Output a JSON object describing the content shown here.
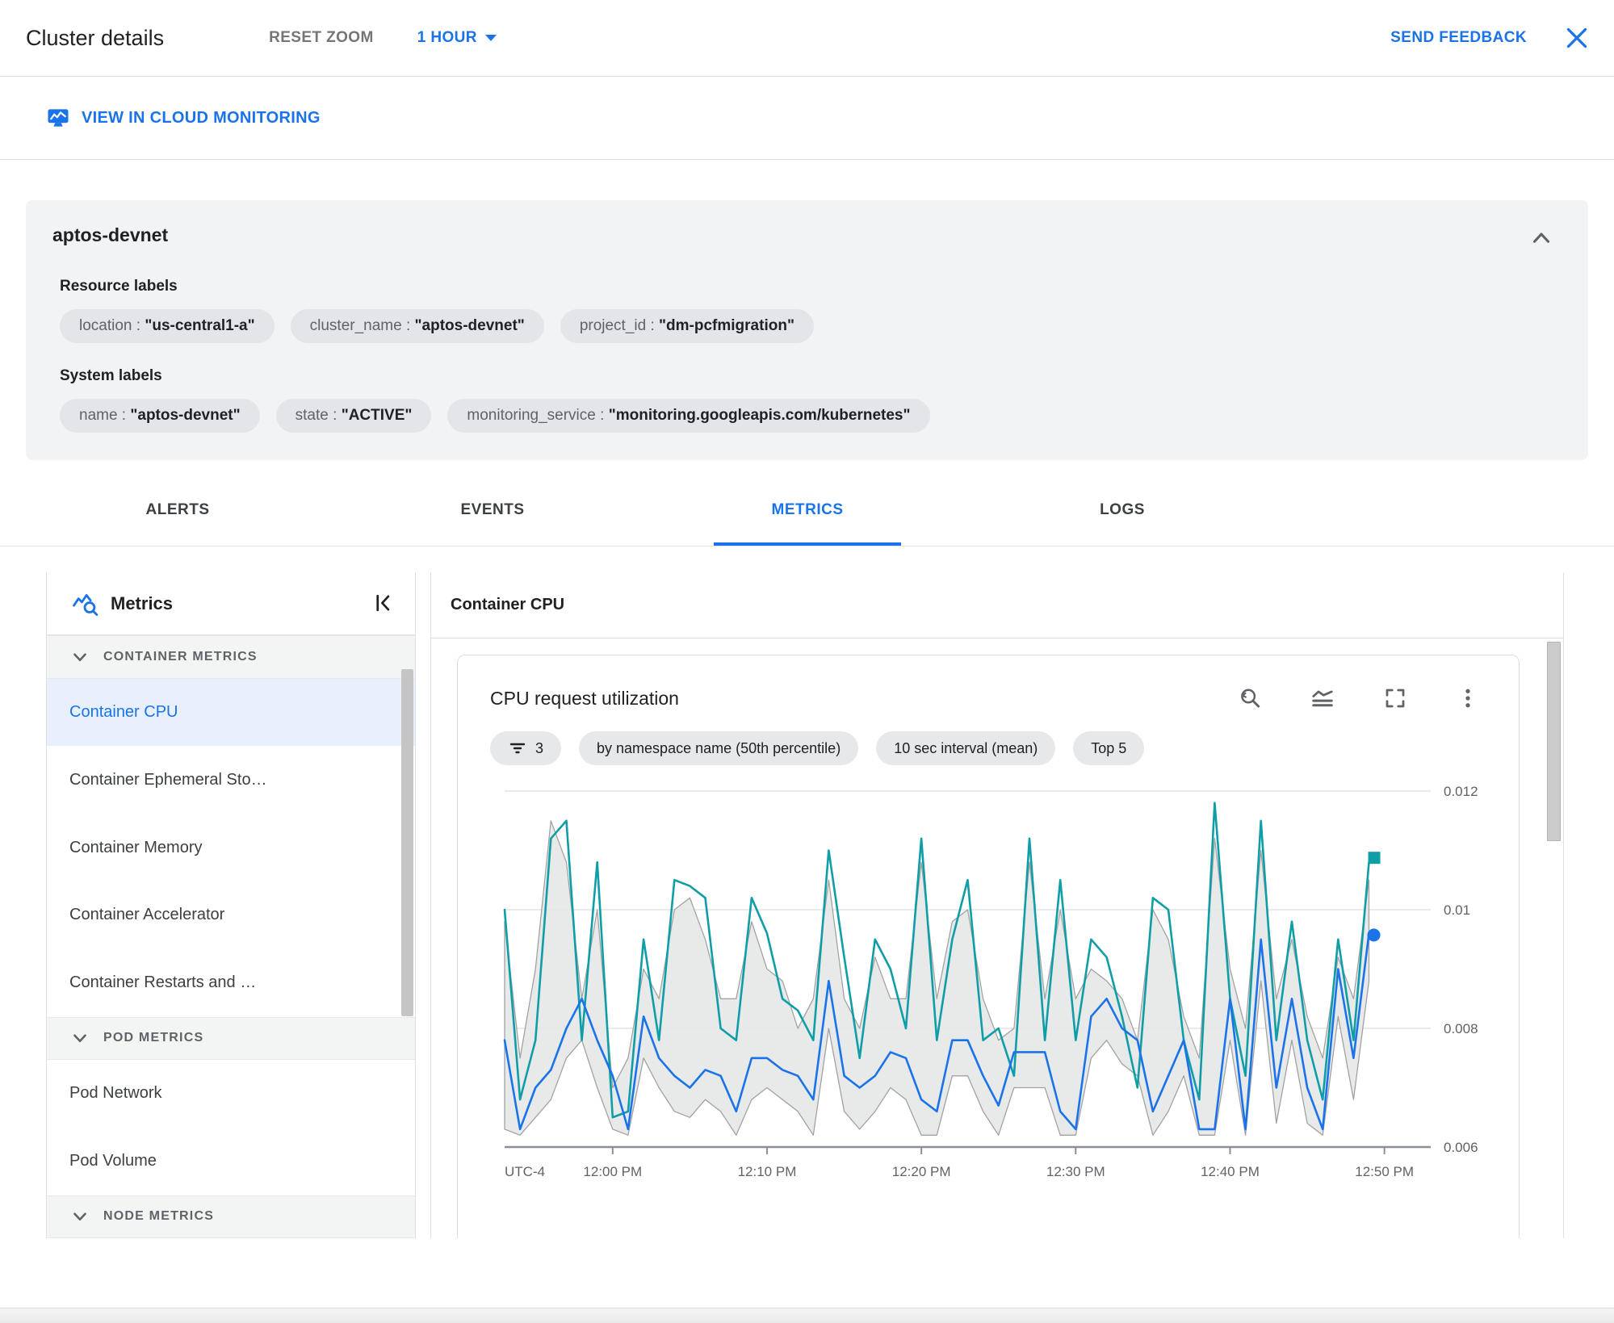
{
  "header": {
    "title": "Cluster details",
    "reset_zoom_label": "RESET ZOOM",
    "time_range_label": "1 HOUR",
    "send_feedback_label": "SEND FEEDBACK"
  },
  "monitoring_link": {
    "label": "VIEW IN CLOUD MONITORING"
  },
  "cluster_panel": {
    "title": "aptos-devnet",
    "resource_labels_heading": "Resource labels",
    "resource_labels": [
      {
        "key": "location",
        "value": "\"us-central1-a\""
      },
      {
        "key": "cluster_name",
        "value": "\"aptos-devnet\""
      },
      {
        "key": "project_id",
        "value": "\"dm-pcfmigration\""
      }
    ],
    "system_labels_heading": "System labels",
    "system_labels": [
      {
        "key": "name",
        "value": "\"aptos-devnet\""
      },
      {
        "key": "state",
        "value": "\"ACTIVE\""
      },
      {
        "key": "monitoring_service",
        "value": "\"monitoring.googleapis.com/kubernetes\""
      }
    ]
  },
  "tabs": [
    {
      "label": "ALERTS",
      "active": false
    },
    {
      "label": "EVENTS",
      "active": false
    },
    {
      "label": "METRICS",
      "active": true
    },
    {
      "label": "LOGS",
      "active": false
    }
  ],
  "sidebar": {
    "title": "Metrics",
    "sections": [
      {
        "heading": "CONTAINER METRICS",
        "items": [
          {
            "label": "Container CPU",
            "selected": true
          },
          {
            "label": "Container Ephemeral Sto…",
            "selected": false
          },
          {
            "label": "Container Memory",
            "selected": false
          },
          {
            "label": "Container Accelerator",
            "selected": false
          },
          {
            "label": "Container Restarts and …",
            "selected": false
          }
        ]
      },
      {
        "heading": "POD METRICS",
        "items": [
          {
            "label": "Pod Network",
            "selected": false
          },
          {
            "label": "Pod Volume",
            "selected": false
          }
        ]
      },
      {
        "heading": "NODE METRICS",
        "items": []
      }
    ]
  },
  "main": {
    "heading": "Container CPU",
    "chart_card": {
      "title": "CPU request utilization",
      "filter_chip_count": "3",
      "chips": [
        "by namespace name (50th percentile)",
        "10 sec interval (mean)",
        "Top 5"
      ],
      "icons": [
        "zoom-reset-icon",
        "legend-toggle-icon",
        "fullscreen-icon",
        "more-vert-icon"
      ]
    }
  },
  "colors": {
    "accent_blue": "#1a73e8",
    "chart_teal": "#0f9da8",
    "chart_blue": "#1a73e8",
    "band_fill": "#e7e8e8",
    "band_stroke": "#9e9e9e"
  },
  "chart_data": {
    "type": "line",
    "title": "CPU request utilization",
    "x_axis_prefix_label": "UTC-4",
    "x_span_minutes": 60,
    "sample_interval_minutes": 1,
    "x_ticks": [
      {
        "label": "12:00 PM",
        "minute": 7
      },
      {
        "label": "12:10 PM",
        "minute": 17
      },
      {
        "label": "12:20 PM",
        "minute": 27
      },
      {
        "label": "12:30 PM",
        "minute": 37
      },
      {
        "label": "12:40 PM",
        "minute": 47
      },
      {
        "label": "12:50 PM",
        "minute": 57
      }
    ],
    "y_ticks": [
      0.012,
      0.01,
      0.008,
      0.006
    ],
    "y_min": 0.006,
    "y_max": 0.012,
    "grid": true,
    "legend": "none",
    "series": [
      {
        "name": "series_band_minmax",
        "type": "band",
        "stroke": "#9e9e9e",
        "fill": "#e7e8e8",
        "upper": [
          0.0098,
          0.0075,
          0.009,
          0.0115,
          0.0108,
          0.0085,
          0.01,
          0.007,
          0.0075,
          0.009,
          0.0085,
          0.01,
          0.0102,
          0.0095,
          0.0085,
          0.0085,
          0.0098,
          0.009,
          0.0088,
          0.008,
          0.0085,
          0.0105,
          0.0085,
          0.008,
          0.0092,
          0.0085,
          0.0085,
          0.0108,
          0.0085,
          0.0098,
          0.01,
          0.0085,
          0.0078,
          0.008,
          0.0108,
          0.0085,
          0.01,
          0.0085,
          0.009,
          0.0088,
          0.0085,
          0.0078,
          0.01,
          0.0095,
          0.0082,
          0.0075,
          0.0112,
          0.009,
          0.008,
          0.011,
          0.0085,
          0.0095,
          0.0082,
          0.0075,
          0.0092,
          0.0085,
          0.0105
        ],
        "lower": [
          0.0063,
          0.0062,
          0.0065,
          0.0068,
          0.0075,
          0.0078,
          0.007,
          0.0063,
          0.0062,
          0.0075,
          0.007,
          0.0066,
          0.0065,
          0.0068,
          0.0066,
          0.0062,
          0.0068,
          0.007,
          0.0068,
          0.0066,
          0.0062,
          0.008,
          0.0066,
          0.0063,
          0.0066,
          0.007,
          0.0068,
          0.0062,
          0.0062,
          0.0072,
          0.0072,
          0.0066,
          0.0062,
          0.007,
          0.007,
          0.007,
          0.0062,
          0.0062,
          0.0075,
          0.0078,
          0.0074,
          0.0072,
          0.0062,
          0.0066,
          0.0072,
          0.0062,
          0.0062,
          0.0078,
          0.0062,
          0.0088,
          0.0064,
          0.0078,
          0.0064,
          0.0062,
          0.0082,
          0.0068,
          0.0088
        ]
      },
      {
        "name": "series_teal",
        "type": "line",
        "color": "#0f9da8",
        "end_marker": "square",
        "values": [
          0.01,
          0.0068,
          0.0078,
          0.0112,
          0.0115,
          0.0078,
          0.0108,
          0.0065,
          0.0066,
          0.0095,
          0.0078,
          0.0105,
          0.0104,
          0.0102,
          0.008,
          0.0078,
          0.0102,
          0.0096,
          0.0085,
          0.0083,
          0.0078,
          0.011,
          0.0092,
          0.0075,
          0.0095,
          0.009,
          0.008,
          0.0112,
          0.0078,
          0.0095,
          0.0105,
          0.0078,
          0.008,
          0.0072,
          0.0112,
          0.0078,
          0.0105,
          0.0078,
          0.0095,
          0.0092,
          0.0082,
          0.007,
          0.0102,
          0.01,
          0.0078,
          0.0068,
          0.0118,
          0.0085,
          0.0072,
          0.0115,
          0.0078,
          0.0098,
          0.0078,
          0.0068,
          0.0095,
          0.0078,
          0.0108
        ]
      },
      {
        "name": "series_blue",
        "type": "line",
        "color": "#1a73e8",
        "end_marker": "circle",
        "values": [
          0.0078,
          0.0063,
          0.007,
          0.0073,
          0.008,
          0.0085,
          0.0078,
          0.0072,
          0.0063,
          0.0082,
          0.0075,
          0.0072,
          0.007,
          0.0073,
          0.0072,
          0.0066,
          0.0075,
          0.0075,
          0.0073,
          0.0072,
          0.0068,
          0.0088,
          0.0072,
          0.007,
          0.0072,
          0.0076,
          0.0075,
          0.0068,
          0.0066,
          0.0078,
          0.0078,
          0.0072,
          0.0067,
          0.0076,
          0.0076,
          0.0076,
          0.0066,
          0.0063,
          0.0082,
          0.0085,
          0.008,
          0.0078,
          0.0066,
          0.0072,
          0.0078,
          0.0063,
          0.0063,
          0.0085,
          0.0063,
          0.0095,
          0.007,
          0.0085,
          0.007,
          0.0063,
          0.009,
          0.0075,
          0.0096
        ]
      }
    ]
  }
}
